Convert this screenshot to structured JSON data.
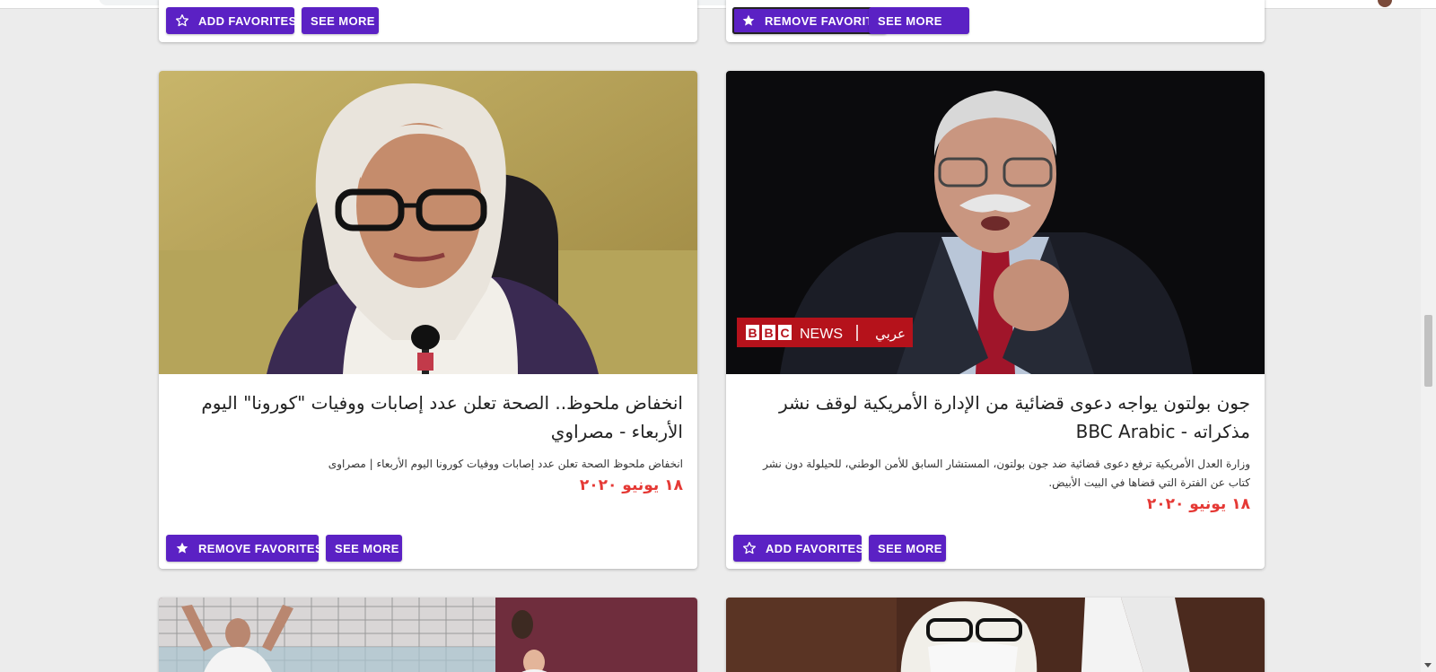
{
  "colors": {
    "accent": "#5b21c4",
    "date": "#e53935",
    "background": "#ececec"
  },
  "top_row": {
    "left": {
      "favorite_label": "ADD FAVORITES",
      "favorite_icon": "star-outline-icon",
      "see_more_label": "SEE MORE"
    },
    "right": {
      "favorite_label": "REMOVE FAVORITES",
      "favorite_icon": "star-filled-icon",
      "see_more_label": "SEE MORE"
    }
  },
  "cards": [
    {
      "image": "woman-in-hijab-glasses-microphone",
      "title": "انخفاض ملحوظ.. الصحة تعلن عدد إصابات ووفيات \"كورونا\" اليوم الأربعاء - مصراوي",
      "description": "انخفاض ملحوظ الصحة تعلن عدد إصابات ووفيات كورونا اليوم الأربعاء | مصراوى",
      "date": "١٨ يونيو ٢٠٢٠",
      "favorite_label": "REMOVE FAVORITES",
      "favorite_icon": "star-filled-icon",
      "see_more_label": "SEE MORE"
    },
    {
      "image": "man-with-mustache-speaking",
      "badge": {
        "brand": "BBC",
        "news": "NEWS",
        "arabic": "عربي"
      },
      "title": "جون بولتون يواجه دعوى قضائية من الإدارة الأمريكية لوقف نشر مذكراته - BBC Arabic",
      "description": "وزارة العدل الأمريكية ترفع دعوى قضائية ضد جون بولتون، المستشار السابق للأمن الوطني، للحيلولة دون نشر كتاب عن الفترة التي قضاها في البيت الأبيض.",
      "date": "١٨ يونيو ٢٠٢٠",
      "favorite_label": "ADD FAVORITES",
      "favorite_icon": "star-outline-icon",
      "see_more_label": "SEE MORE"
    }
  ],
  "bottom_row": {
    "left": {
      "image": "football-players-celebrating"
    },
    "right": {
      "image": "woman-in-hijab-face-mask"
    }
  }
}
